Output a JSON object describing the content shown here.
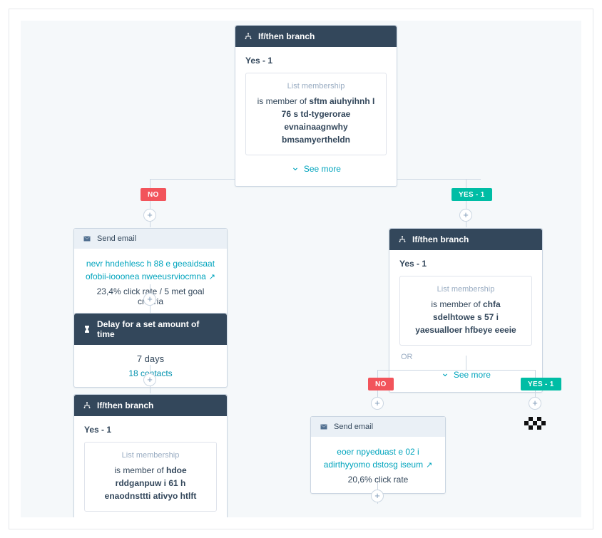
{
  "nodes": {
    "topBranch": {
      "title": "If/then branch",
      "optionLabel": "Yes - 1",
      "chipLabel": "List membership",
      "chipPrefix": "is member of ",
      "chipBold": "sftm aiuhyihnh I 76 s td-tygerorae evnainaagnwhy bmsamyertheldn",
      "seeMore": "See more"
    },
    "noBadge": "NO",
    "yesBadge": "YES - 1",
    "leftEmail": {
      "title": "Send email",
      "link": "nevr hndehlesc h 88 e geeaidsaat ofobii-iooonea nweeusrviocmna",
      "stats": "23,4% click rate / 5 met goal criteria"
    },
    "delay": {
      "title": "Delay for a set amount of time",
      "days": "7 days",
      "contacts": "18 contacts"
    },
    "leftBottomBranch": {
      "title": "If/then branch",
      "optionLabel": "Yes - 1",
      "chipLabel": "List membership",
      "chipPrefix": "is member of ",
      "chipBold": "hdoe rddganpuw i 61 h enaodnsttti ativyo htlft"
    },
    "rightBranch": {
      "title": "If/then branch",
      "optionLabel": "Yes - 1",
      "chipLabel": "List membership",
      "chipPrefix": "is member of ",
      "chipBold": "chfa sdelhtowe s 57 i yaesualloer hfbeye eeeie",
      "or": "OR",
      "seeMore": "See more"
    },
    "rightNoBadge": "NO",
    "rightYesBadge": "YES - 1",
    "rightEmail": {
      "title": "Send email",
      "link": "eoer npyeduast e 02 i adirthyyomo dstosg iseum",
      "stats": "20,6% click rate"
    }
  }
}
